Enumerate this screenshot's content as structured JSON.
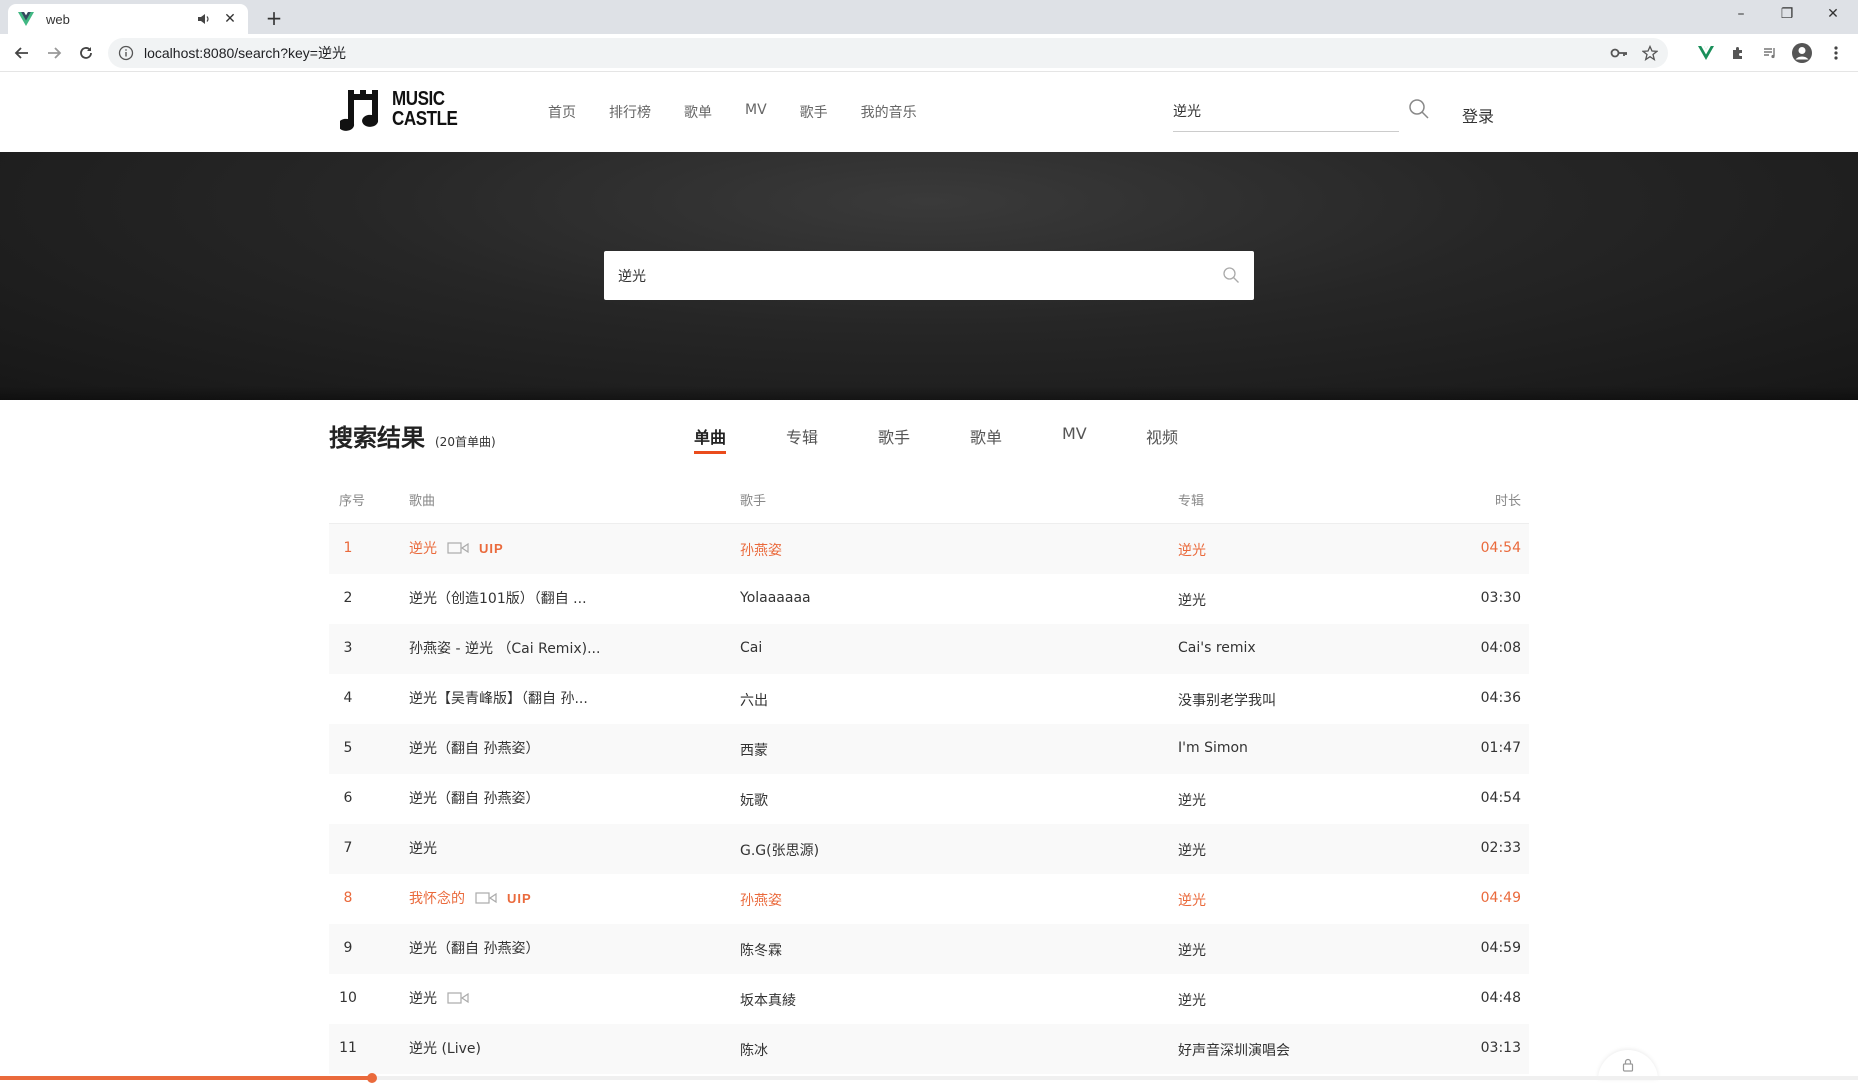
{
  "browser": {
    "tab_title": "web",
    "tab_close": "✕",
    "new_tab": "+",
    "url": "localhost:8080/search?key=逆光",
    "window": {
      "minimize": "–",
      "restore": "❐",
      "close": "✕"
    }
  },
  "logo": {
    "line1": "MUSIC",
    "line2": "CASTLE"
  },
  "nav": [
    "首页",
    "排行榜",
    "歌单",
    "MV",
    "歌手",
    "我的音乐"
  ],
  "header": {
    "search_value": "逆光",
    "login": "登录"
  },
  "banner": {
    "search_value": "逆光"
  },
  "results": {
    "title": "搜索结果",
    "count": "(20首单曲)",
    "tabs": [
      "单曲",
      "专辑",
      "歌手",
      "歌单",
      "MV",
      "视频"
    ],
    "active_tab": "单曲"
  },
  "columns": {
    "index": "序号",
    "song": "歌曲",
    "artist": "歌手",
    "album": "专辑",
    "duration": "时长"
  },
  "vip_label": "UIP",
  "songs": [
    {
      "idx": "1",
      "title": "逆光",
      "artist": "孙燕姿",
      "album": "逆光",
      "duration": "04:54"
    },
    {
      "idx": "2",
      "title": "逆光（创造101版）（翻自 ...",
      "artist": "Yolaaaaaa",
      "album": "逆光",
      "duration": "03:30"
    },
    {
      "idx": "3",
      "title": "孙燕姿 - 逆光 （Cai Remix)...",
      "artist": "Cai",
      "album": "Cai's remix",
      "duration": "04:08"
    },
    {
      "idx": "4",
      "title": "逆光【吴青峰版】（翻自 孙...",
      "artist": "六出",
      "album": "没事别老学我叫",
      "duration": "04:36"
    },
    {
      "idx": "5",
      "title": "逆光（翻自 孙燕姿）",
      "artist": "西蒙",
      "album": "I'm Simon",
      "duration": "01:47"
    },
    {
      "idx": "6",
      "title": "逆光（翻自 孙燕姿）",
      "artist": "妧歌",
      "album": "逆光",
      "duration": "04:54"
    },
    {
      "idx": "7",
      "title": "逆光",
      "artist": "G.G(张思源)",
      "album": "逆光",
      "duration": "02:33"
    },
    {
      "idx": "8",
      "title": "我怀念的",
      "artist": "孙燕姿",
      "album": "逆光",
      "duration": "04:49"
    },
    {
      "idx": "9",
      "title": "逆光（翻自 孙燕姿）",
      "artist": "陈冬霖",
      "album": "逆光",
      "duration": "04:59"
    },
    {
      "idx": "10",
      "title": "逆光",
      "artist": "坂本真綾",
      "album": "逆光",
      "duration": "04:48"
    },
    {
      "idx": "11",
      "title": "逆光 (Live)",
      "artist": "陈冰",
      "album": "好声音深圳演唱会",
      "duration": "03:13"
    }
  ],
  "player": {
    "progress": 0.2
  },
  "colors": {
    "accent": "#ea6a3c",
    "tab_underline": "#ea4c1c",
    "banner": "#1e1e1e"
  },
  "icons": [
    "vue-favicon",
    "speaker-icon",
    "back-icon",
    "forward-icon",
    "reload-icon",
    "info-icon",
    "key-icon",
    "star-icon",
    "extensions-icon",
    "media-icon",
    "profile-icon",
    "menu-icon",
    "search-icon",
    "mv-icon",
    "lock-icon"
  ]
}
